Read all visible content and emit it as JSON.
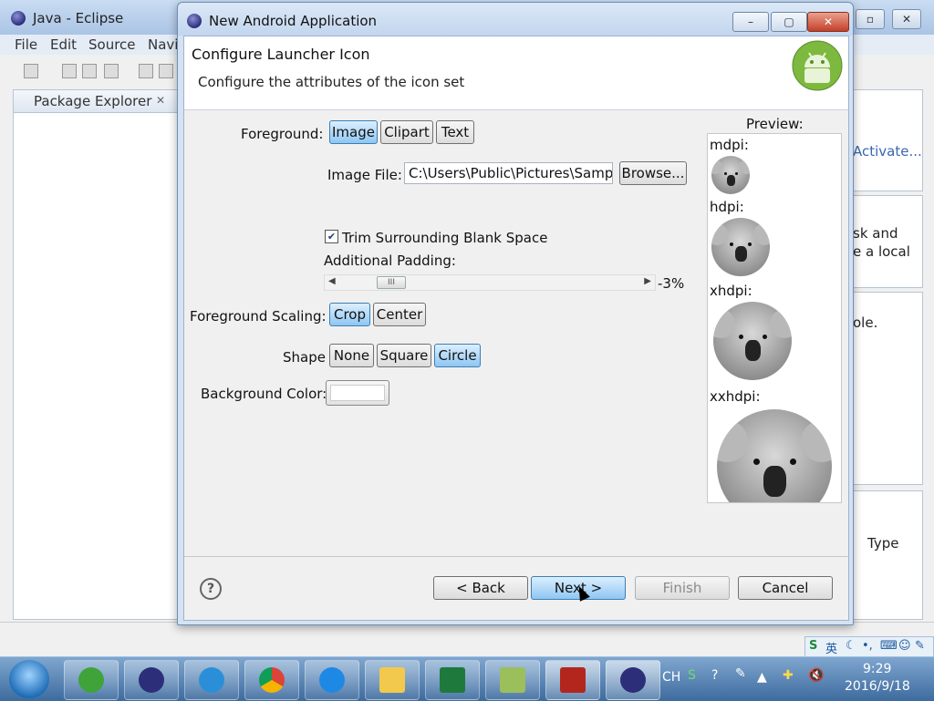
{
  "eclipse": {
    "title": "Java - Eclipse",
    "menu": [
      "File",
      "Edit",
      "Source",
      "Navi"
    ],
    "package_explorer_tab": "Package Explorer",
    "right_panel_text": {
      "activate": "Activate...",
      "task_line1": "sk and",
      "task_line2": "e a local",
      "console_text": "ole.",
      "type_header": "Type"
    }
  },
  "dialog": {
    "title": "New Android Application",
    "header_title": "Configure Launcher Icon",
    "header_subtitle": "Configure the attributes of the icon set",
    "foreground_label": "Foreground:",
    "foreground_options": [
      "Image",
      "Clipart",
      "Text"
    ],
    "foreground_selected": "Image",
    "image_file_label": "Image File:",
    "image_file_value": "C:\\Users\\Public\\Pictures\\Sampl",
    "browse_label": "Browse...",
    "trim_label": "Trim Surrounding Blank Space",
    "trim_checked": true,
    "padding_label": "Additional Padding:",
    "padding_value_text": "-3%",
    "padding_slider_fraction": 0.14,
    "scaling_label": "Foreground Scaling:",
    "scaling_options": [
      "Crop",
      "Center"
    ],
    "scaling_selected": "Crop",
    "shape_label": "Shape",
    "shape_options": [
      "None",
      "Square",
      "Circle"
    ],
    "shape_selected": "Circle",
    "background_label": "Background Color:",
    "background_color": "#ffffff",
    "preview_label": "Preview:",
    "preview_sizes": [
      "mdpi:",
      "hdpi:",
      "xhdpi:",
      "xxhdpi:"
    ],
    "back_label": "< Back",
    "next_label": "Next >",
    "finish_label": "Finish",
    "cancel_label": "Cancel"
  },
  "taskbar": {
    "lang": "CH",
    "time": "9:29",
    "date": "2016/9/18",
    "ime_char": "英"
  },
  "colors": {
    "selected_button": "#8ec6f3",
    "dialog_frame": "#d4e2f3",
    "close_button": "#c4402a",
    "taskbar": "#3d6b9e"
  }
}
